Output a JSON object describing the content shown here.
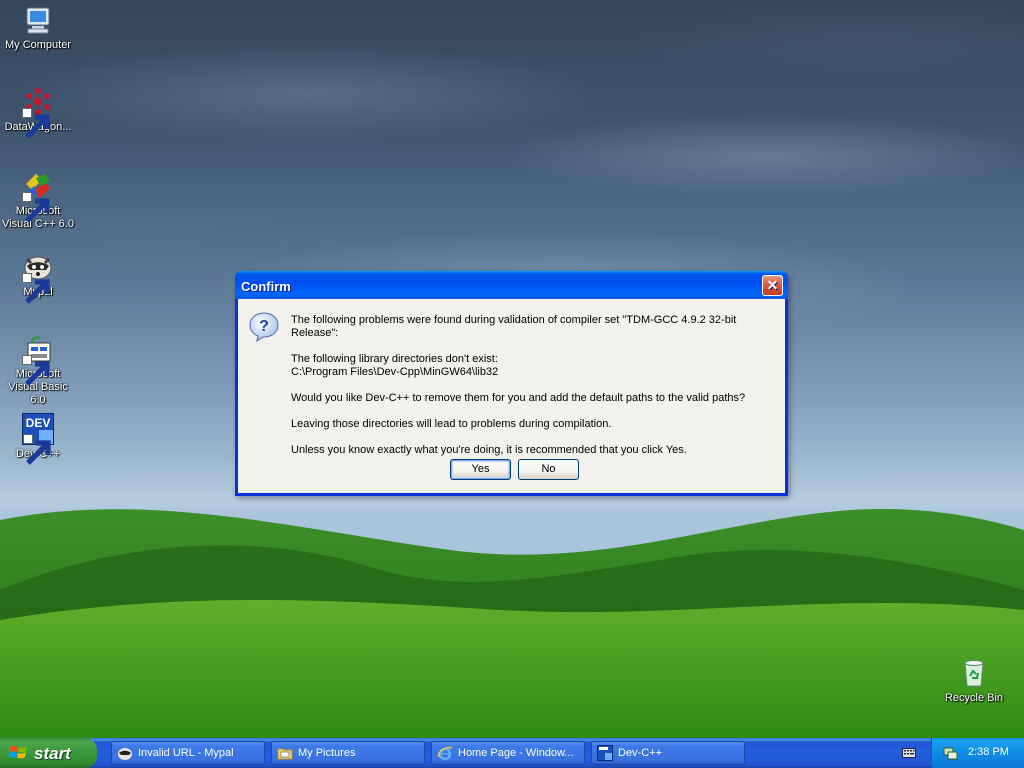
{
  "desktop": {
    "icons": [
      {
        "label": "My Computer",
        "icon": "my-computer-icon"
      },
      {
        "label": "DataWagon...",
        "icon": "datawagon-icon"
      },
      {
        "label": "Microsoft Visual C++ 6.0",
        "icon": "visual-cpp-icon"
      },
      {
        "label": "Mypal",
        "icon": "mypal-icon"
      },
      {
        "label": "Microsoft Visual Basic 6.0",
        "icon": "visual-basic-icon"
      },
      {
        "label": "Dev-C++",
        "icon": "devcpp-icon"
      },
      {
        "label": "Recycle Bin",
        "icon": "recycle-bin-icon"
      }
    ],
    "devcpp_icon_text": "DEV"
  },
  "dialog": {
    "title": "Confirm",
    "close_label": "✕",
    "icon": "question-icon",
    "lines": {
      "intro": "The following problems were found during validation of compiler set \"TDM-GCC 4.9.2 32-bit Release\":",
      "missing_heading": "The following library directories don't exist:",
      "missing_path": "C:\\Program Files\\Dev-Cpp\\MinGW64\\lib32",
      "question": "Would you like Dev-C++ to remove them for you and add the default paths to the valid paths?",
      "warning": "Leaving those directories will lead to problems during compilation.",
      "recommendation": "Unless you know exactly what you're doing, it is recommended that you click Yes."
    },
    "buttons": {
      "yes": "Yes",
      "no": "No"
    }
  },
  "taskbar": {
    "start_label": "start",
    "tasks": [
      {
        "label": "Invalid URL - Mypal",
        "icon": "mypal-icon"
      },
      {
        "label": "My Pictures",
        "icon": "folder-icon"
      },
      {
        "label": "Home Page - Window...",
        "icon": "ie-icon"
      },
      {
        "label": "Dev-C++",
        "icon": "devcpp-icon"
      }
    ],
    "tray": {
      "clock": "2:38 PM"
    }
  },
  "colors": {
    "title_blue": "#0054e3",
    "start_green": "#3c9a3c",
    "taskbar_blue": "#245ddb"
  }
}
